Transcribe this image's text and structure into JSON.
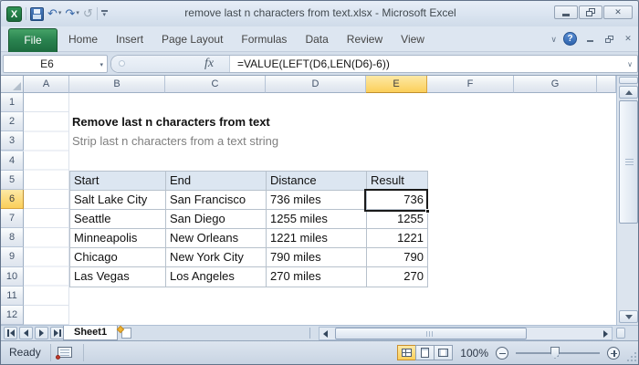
{
  "titlebar": {
    "title": "remove last n characters from text.xlsx - Microsoft Excel"
  },
  "ribbon": {
    "file_tab": "File",
    "tabs": [
      "Home",
      "Insert",
      "Page Layout",
      "Formulas",
      "Data",
      "Review",
      "View"
    ]
  },
  "formula_bar": {
    "name_box": "E6",
    "fx_label": "fx",
    "formula": "=VALUE(LEFT(D6,LEN(D6)-6))"
  },
  "sheet": {
    "column_letters": [
      "A",
      "B",
      "C",
      "D",
      "E",
      "F",
      "G"
    ],
    "row_numbers": [
      "1",
      "2",
      "3",
      "4",
      "5",
      "6",
      "7",
      "8",
      "9",
      "10",
      "11",
      "12"
    ],
    "active_cell": "E6",
    "active_column": "E",
    "active_row": "6",
    "active_cell_value": "736",
    "doc_title": "Remove last n characters from text",
    "doc_subtitle": "Strip last n characters from a text string",
    "table": {
      "headers": [
        "Start",
        "End",
        "Distance",
        "Result"
      ],
      "rows": [
        [
          "Salt Lake City",
          "San Francisco",
          "736 miles",
          "736"
        ],
        [
          "Seattle",
          "San Diego",
          "1255 miles",
          "1255"
        ],
        [
          "Minneapolis",
          "New Orleans",
          "1221 miles",
          "1221"
        ],
        [
          "Chicago",
          "New York City",
          "790 miles",
          "790"
        ],
        [
          "Las Vegas",
          "Los Angeles",
          "270 miles",
          "270"
        ]
      ]
    }
  },
  "sheet_tabs": {
    "active": "Sheet1"
  },
  "status_bar": {
    "mode": "Ready",
    "zoom_level": "100%"
  },
  "icons": {
    "excel_logo": "X",
    "undo": "↶",
    "redo": "↷",
    "repeat": "↺",
    "dropdown": "▾",
    "collapse_ribbon": "∨",
    "help": "?",
    "close": "✕",
    "name_box_dropdown": "▾",
    "formula_expand": "∨"
  },
  "colors": {
    "file_tab_green": "#1e7043",
    "selected_header_fill": "#fbcf5a",
    "table_header_fill": "#dce6f1",
    "selection_border": "#1a1a1a",
    "help_button_blue": "#2f64ad",
    "save_icon_blue": "#2b5a98"
  }
}
